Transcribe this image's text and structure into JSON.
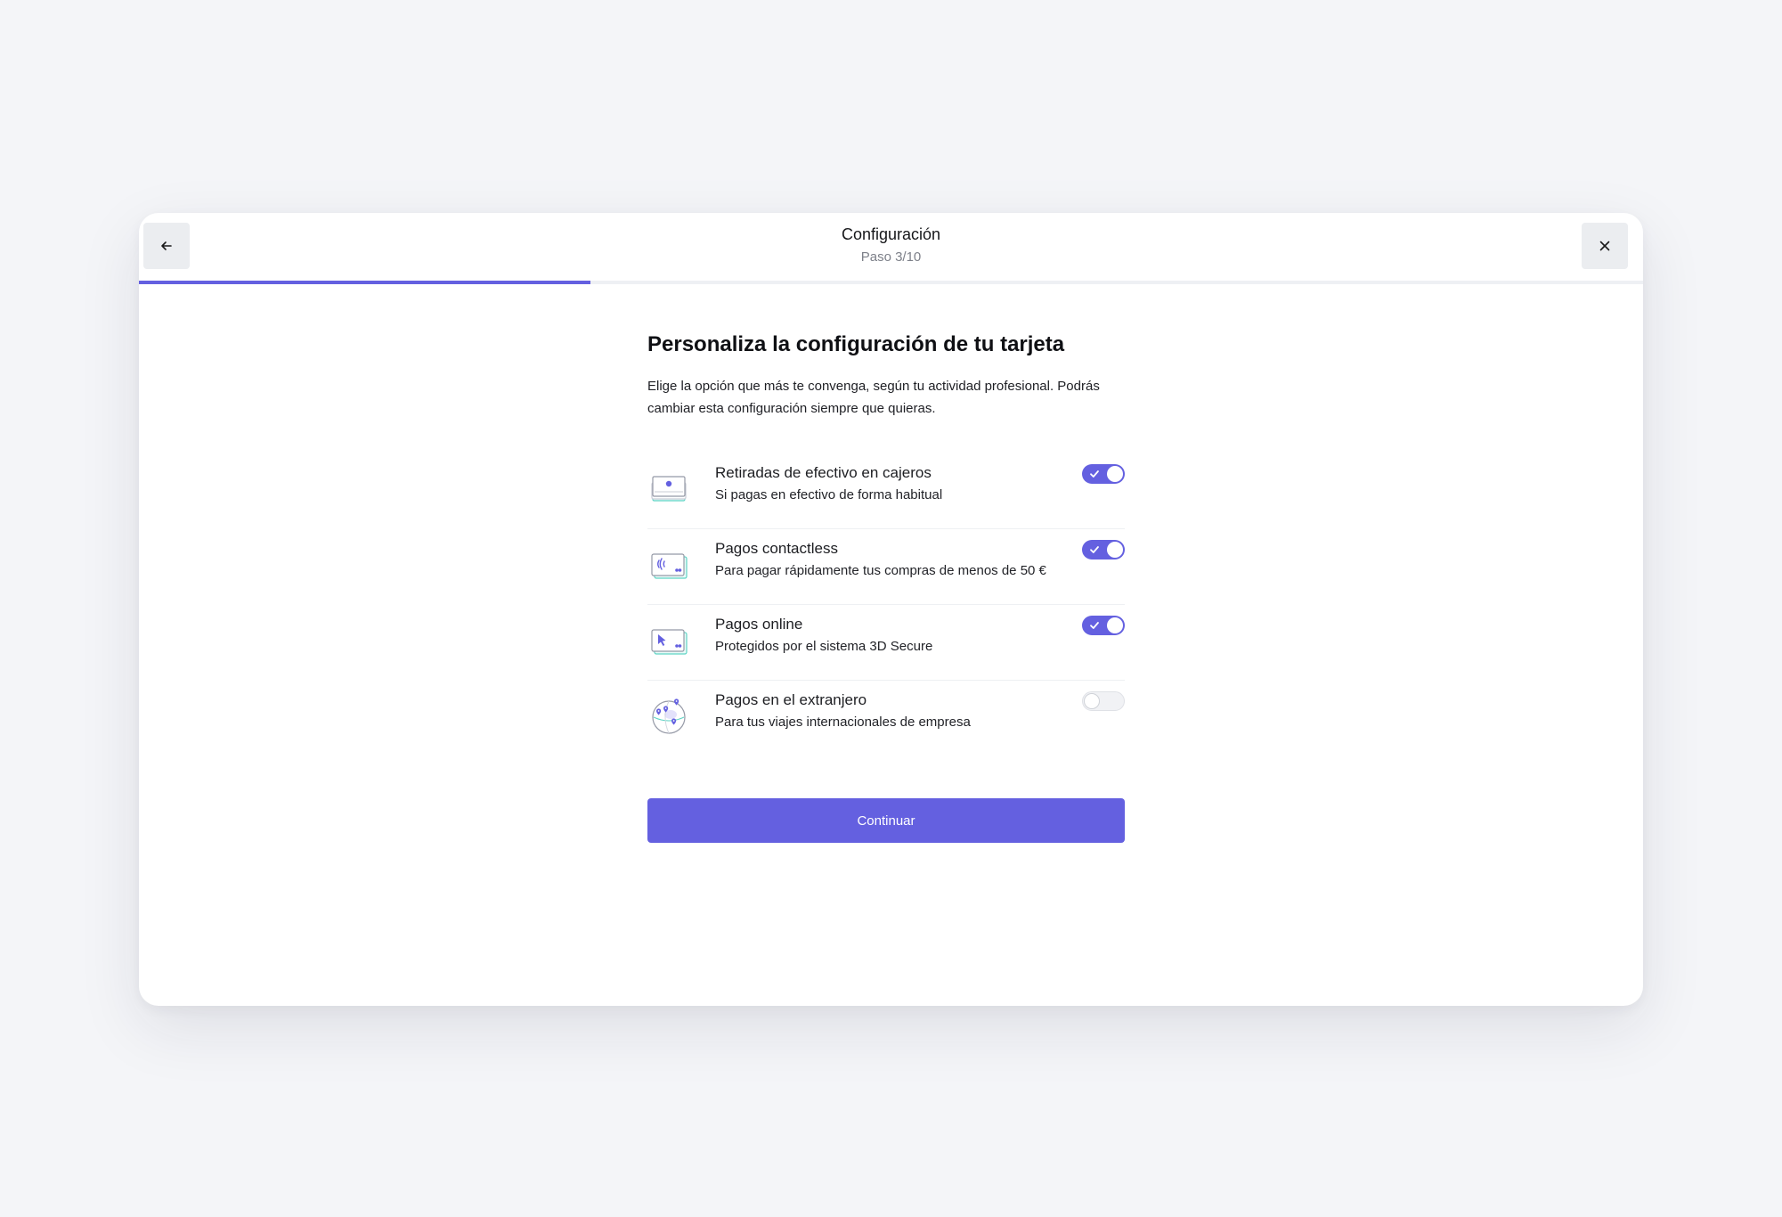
{
  "header": {
    "title": "Configuración",
    "step": "Paso 3/10",
    "progress": 0.3
  },
  "main": {
    "title": "Personaliza la configuración de tu tarjeta",
    "description": "Elige la opción que más te convenga, según tu actividad profesional. Podrás cambiar esta configuración siempre que quieras."
  },
  "options": [
    {
      "title": "Retiradas de efectivo en cajeros",
      "subtitle": "Si pagas en efectivo de forma habitual",
      "enabled": true,
      "icon": "atm-cash-icon"
    },
    {
      "title": "Pagos contactless",
      "subtitle": "Para pagar rápidamente tus compras de menos de 50 €",
      "enabled": true,
      "icon": "contactless-card-icon"
    },
    {
      "title": "Pagos online",
      "subtitle": "Protegidos por el sistema 3D Secure",
      "enabled": true,
      "icon": "online-card-cursor-icon"
    },
    {
      "title": "Pagos en el extranjero",
      "subtitle": "Para tus viajes internacionales de empresa",
      "enabled": false,
      "icon": "globe-pins-icon"
    }
  ],
  "actions": {
    "continue_label": "Continuar"
  },
  "colors": {
    "accent": "#6460e0",
    "teal": "#5fd3c4",
    "background": "#f4f5f8"
  }
}
